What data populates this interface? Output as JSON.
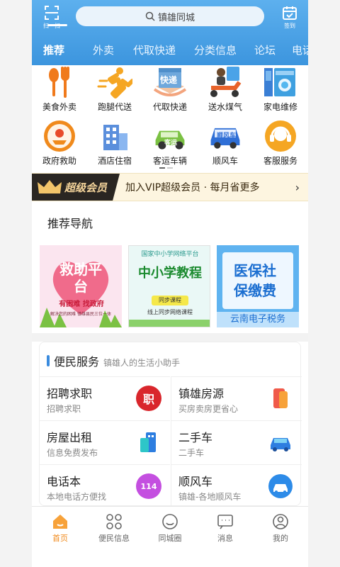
{
  "header": {
    "scan_label": "扫一扫",
    "search_text": "镇雄同城",
    "checkin_label": "签到"
  },
  "tabs": [
    {
      "label": "推荐"
    },
    {
      "label": "外卖"
    },
    {
      "label": "代取快递"
    },
    {
      "label": "分类信息"
    },
    {
      "label": "论坛"
    },
    {
      "label": "电话"
    }
  ],
  "grid": [
    {
      "label": "美食外卖",
      "icon": "fork-spoon-icon"
    },
    {
      "label": "跑腿代送",
      "icon": "runner-icon"
    },
    {
      "label": "代取快递",
      "icon": "express-box-icon",
      "badge": "快递"
    },
    {
      "label": "送水煤气",
      "icon": "delivery-scooter-icon"
    },
    {
      "label": "家电维修",
      "icon": "appliance-icon"
    },
    {
      "label": "政府救助",
      "icon": "aid-badge-icon"
    },
    {
      "label": "酒店住宿",
      "icon": "hotel-icon"
    },
    {
      "label": "客运车辆",
      "icon": "car-icon",
      "badge": "客运"
    },
    {
      "label": "顺风车",
      "icon": "rideshare-car-icon",
      "badge": "顺风车"
    },
    {
      "label": "客服服务",
      "icon": "headset-icon"
    }
  ],
  "vip": {
    "badge": "超级会员",
    "text": "加入VIP超级会员 · 每月省更多"
  },
  "recommend": {
    "title": "推荐导航",
    "banners": [
      {
        "title": "救助平台",
        "sub": "有困难 找政府",
        "note": "解决您的困难 镇雄县民三位一体"
      },
      {
        "top": "国家中小学网络平台",
        "title": "中小学教程",
        "tag": "同步课程",
        "sub": "线上同步网络课程"
      },
      {
        "title1": "医保社",
        "title2": "保缴费",
        "bottom": "云南电子税务"
      }
    ]
  },
  "services": {
    "title": "便民服务",
    "subtitle": "镇雄人的生活小助手",
    "items": [
      {
        "name": "招聘求职",
        "desc": "招聘求职",
        "icon": "job-icon",
        "glyph": "职"
      },
      {
        "name": "镇雄房源",
        "desc": "买房卖房更省心",
        "icon": "house-icon"
      },
      {
        "name": "房屋出租",
        "desc": "信息免费发布",
        "icon": "building-icon"
      },
      {
        "name": "二手车",
        "desc": "二手车",
        "icon": "used-car-icon"
      },
      {
        "name": "电话本",
        "desc": "本地电话方便找",
        "icon": "phone-book-icon",
        "glyph": "114"
      },
      {
        "name": "顺风车",
        "desc": "镇雄-各地顺风车",
        "icon": "rideshare-icon"
      }
    ]
  },
  "bottom_nav": [
    {
      "label": "首页",
      "icon": "home-icon",
      "active": true
    },
    {
      "label": "便民信息",
      "icon": "grid-icon"
    },
    {
      "label": "同城圈",
      "icon": "smile-icon"
    },
    {
      "label": "消息",
      "icon": "message-icon"
    },
    {
      "label": "我的",
      "icon": "profile-icon"
    }
  ],
  "colors": {
    "accent": "#3c95de",
    "active": "#f08a1c",
    "vip_gold": "#f3d39a"
  }
}
